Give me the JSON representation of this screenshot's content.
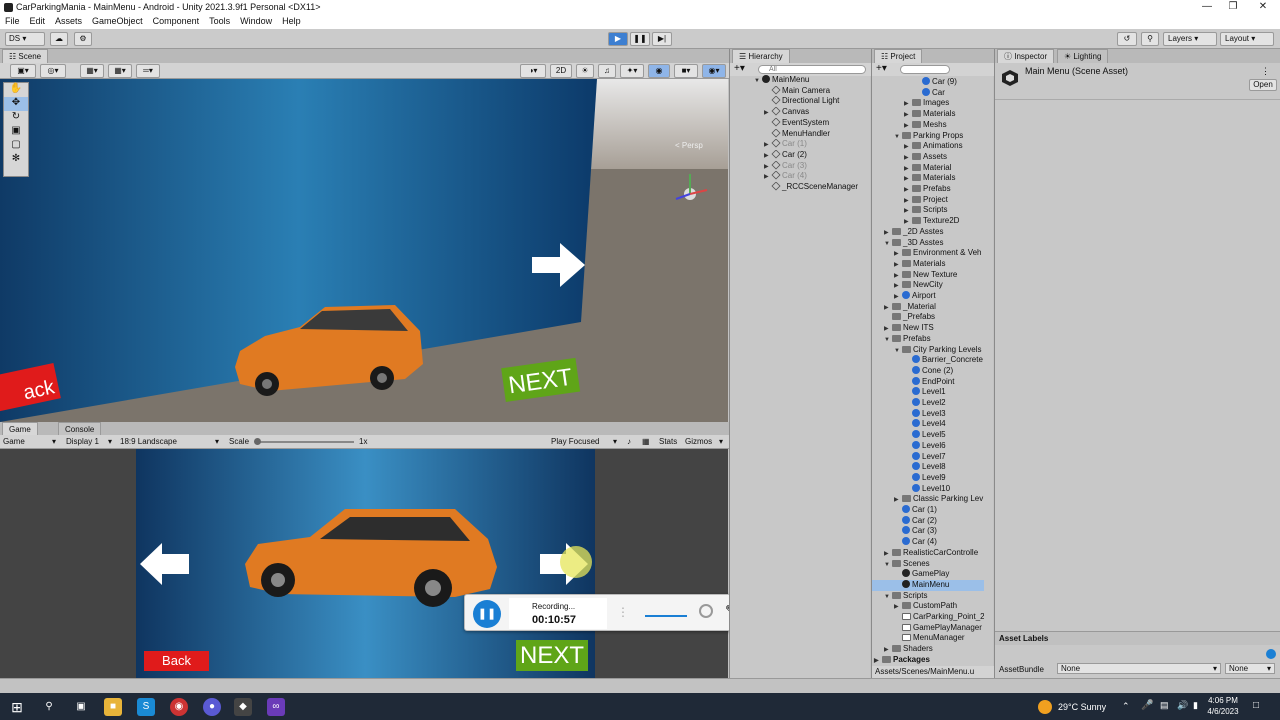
{
  "window": {
    "title": "CarParkingMania - MainMenu - Android - Unity 2021.3.9f1 Personal <DX11>"
  },
  "menu": [
    "File",
    "Edit",
    "Assets",
    "GameObject",
    "Component",
    "Tools",
    "Window",
    "Help"
  ],
  "toolbar": {
    "account": "DS",
    "layers": "Layers",
    "layout": "Layout"
  },
  "scene": {
    "tab": "Scene",
    "mode2d": "2D",
    "persp": "< Persp",
    "next_label": "NEXT",
    "back_label": "ack"
  },
  "game": {
    "tab_game": "Game",
    "tab_console": "Console",
    "game_select": "Game",
    "display": "Display 1",
    "aspect": "18:9 Landscape",
    "scale_label": "Scale",
    "scale_value": "1x",
    "play_focused": "Play Focused",
    "stats": "Stats",
    "gizmos": "Gizmos",
    "back_label": "Back",
    "next_label": "NEXT"
  },
  "recording": {
    "status": "Recording...",
    "time": "00:10:57"
  },
  "hierarchy": {
    "tab": "Hierarchy",
    "search_placeholder": "All",
    "items": [
      {
        "label": "MainMenu",
        "level": 0,
        "icon": "unity",
        "arrow": "open"
      },
      {
        "label": "Main Camera",
        "level": 1,
        "icon": "go"
      },
      {
        "label": "Directional Light",
        "level": 1,
        "icon": "go"
      },
      {
        "label": "Canvas",
        "level": 1,
        "icon": "go",
        "arrow": "closed"
      },
      {
        "label": "EventSystem",
        "level": 1,
        "icon": "go"
      },
      {
        "label": "MenuHandler",
        "level": 1,
        "icon": "go"
      },
      {
        "label": "Car (1)",
        "level": 1,
        "icon": "go",
        "arrow": "closed",
        "dim": true
      },
      {
        "label": "Car (2)",
        "level": 1,
        "icon": "go",
        "arrow": "closed"
      },
      {
        "label": "Car (3)",
        "level": 1,
        "icon": "go",
        "arrow": "closed",
        "dim": true
      },
      {
        "label": "Car (4)",
        "level": 1,
        "icon": "go",
        "arrow": "closed",
        "dim": true
      },
      {
        "label": "_RCCSceneManager",
        "level": 1,
        "icon": "go"
      }
    ]
  },
  "project": {
    "tab": "Project",
    "footer_path": "Assets/Scenes/MainMenu.u",
    "items": [
      {
        "label": "Car (9)",
        "level": 4,
        "icon": "prefab"
      },
      {
        "label": "Car",
        "level": 4,
        "icon": "prefab"
      },
      {
        "label": "Images",
        "level": 3,
        "icon": "folder",
        "arrow": "closed"
      },
      {
        "label": "Materials",
        "level": 3,
        "icon": "folder",
        "arrow": "closed"
      },
      {
        "label": "Meshs",
        "level": 3,
        "icon": "folder",
        "arrow": "closed"
      },
      {
        "label": "Parking Props",
        "level": 2,
        "icon": "folder",
        "arrow": "open"
      },
      {
        "label": "Animations",
        "level": 3,
        "icon": "folder",
        "arrow": "closed"
      },
      {
        "label": "Assets",
        "level": 3,
        "icon": "folder",
        "arrow": "closed"
      },
      {
        "label": "Material",
        "level": 3,
        "icon": "folder",
        "arrow": "closed"
      },
      {
        "label": "Materials",
        "level": 3,
        "icon": "folder",
        "arrow": "closed"
      },
      {
        "label": "Prefabs",
        "level": 3,
        "icon": "folder",
        "arrow": "closed"
      },
      {
        "label": "Project",
        "level": 3,
        "icon": "folder",
        "arrow": "closed"
      },
      {
        "label": "Scripts",
        "level": 3,
        "icon": "folder",
        "arrow": "closed"
      },
      {
        "label": "Texture2D",
        "level": 3,
        "icon": "folder",
        "arrow": "closed"
      },
      {
        "label": "_2D Asstes",
        "level": 1,
        "icon": "folder",
        "arrow": "closed"
      },
      {
        "label": "_3D Asstes",
        "level": 1,
        "icon": "folder",
        "arrow": "open"
      },
      {
        "label": "Environment & Veh",
        "level": 2,
        "icon": "folder",
        "arrow": "closed"
      },
      {
        "label": "Materials",
        "level": 2,
        "icon": "folder",
        "arrow": "closed"
      },
      {
        "label": "New Texture",
        "level": 2,
        "icon": "folder",
        "arrow": "closed"
      },
      {
        "label": "NewCity",
        "level": 2,
        "icon": "folder",
        "arrow": "closed"
      },
      {
        "label": "Airport",
        "level": 2,
        "icon": "prefab",
        "arrow": "closed"
      },
      {
        "label": "_Material",
        "level": 1,
        "icon": "folder",
        "arrow": "closed"
      },
      {
        "label": "_Prefabs",
        "level": 1,
        "icon": "folder"
      },
      {
        "label": "New ITS",
        "level": 1,
        "icon": "folder",
        "arrow": "closed"
      },
      {
        "label": "Prefabs",
        "level": 1,
        "icon": "folder",
        "arrow": "open"
      },
      {
        "label": "City Parking Levels",
        "level": 2,
        "icon": "folder",
        "arrow": "open"
      },
      {
        "label": "Barrier_Concrete",
        "level": 3,
        "icon": "prefab"
      },
      {
        "label": "Cone (2)",
        "level": 3,
        "icon": "prefab"
      },
      {
        "label": "EndPoint",
        "level": 3,
        "icon": "prefab"
      },
      {
        "label": "Level1",
        "level": 3,
        "icon": "prefab"
      },
      {
        "label": "Level2",
        "level": 3,
        "icon": "prefab"
      },
      {
        "label": "Level3",
        "level": 3,
        "icon": "prefab"
      },
      {
        "label": "Level4",
        "level": 3,
        "icon": "prefab"
      },
      {
        "label": "Level5",
        "level": 3,
        "icon": "prefab"
      },
      {
        "label": "Level6",
        "level": 3,
        "icon": "prefab"
      },
      {
        "label": "Level7",
        "level": 3,
        "icon": "prefab"
      },
      {
        "label": "Level8",
        "level": 3,
        "icon": "prefab"
      },
      {
        "label": "Level9",
        "level": 3,
        "icon": "prefab"
      },
      {
        "label": "Level10",
        "level": 3,
        "icon": "prefab"
      },
      {
        "label": "Classic Parking Lev",
        "level": 2,
        "icon": "folder",
        "arrow": "closed"
      },
      {
        "label": "Car (1)",
        "level": 2,
        "icon": "prefab"
      },
      {
        "label": "Car (2)",
        "level": 2,
        "icon": "prefab"
      },
      {
        "label": "Car (3)",
        "level": 2,
        "icon": "prefab"
      },
      {
        "label": "Car (4)",
        "level": 2,
        "icon": "prefab"
      },
      {
        "label": "RealisticCarControlle",
        "level": 1,
        "icon": "folder",
        "arrow": "closed"
      },
      {
        "label": "Scenes",
        "level": 1,
        "icon": "folder",
        "arrow": "open"
      },
      {
        "label": "GamePlay",
        "level": 2,
        "icon": "unity"
      },
      {
        "label": "MainMenu",
        "level": 2,
        "icon": "unity",
        "selected": true
      },
      {
        "label": "Scripts",
        "level": 1,
        "icon": "folder",
        "arrow": "open"
      },
      {
        "label": "CustomPath",
        "level": 2,
        "icon": "folder",
        "arrow": "closed"
      },
      {
        "label": "CarParking_Point_2",
        "level": 2,
        "icon": "script"
      },
      {
        "label": "GamePlayManager",
        "level": 2,
        "icon": "script"
      },
      {
        "label": "MenuManager",
        "level": 2,
        "icon": "script"
      },
      {
        "label": "Shaders",
        "level": 1,
        "icon": "folder",
        "arrow": "closed"
      },
      {
        "label": "Packages",
        "level": 0,
        "icon": "folder",
        "arrow": "closed",
        "bold": true
      }
    ]
  },
  "inspector": {
    "tab": "Inspector",
    "tab2": "Lighting",
    "title": "Main Menu (Scene Asset)",
    "open": "Open",
    "asset_labels": "Asset Labels",
    "assetbundle_label": "AssetBundle",
    "assetbundle_value": "None",
    "variant_value": "None"
  },
  "taskbar": {
    "weather": "29°C  Sunny",
    "time": "4:06 PM",
    "date": "4/6/2023"
  }
}
